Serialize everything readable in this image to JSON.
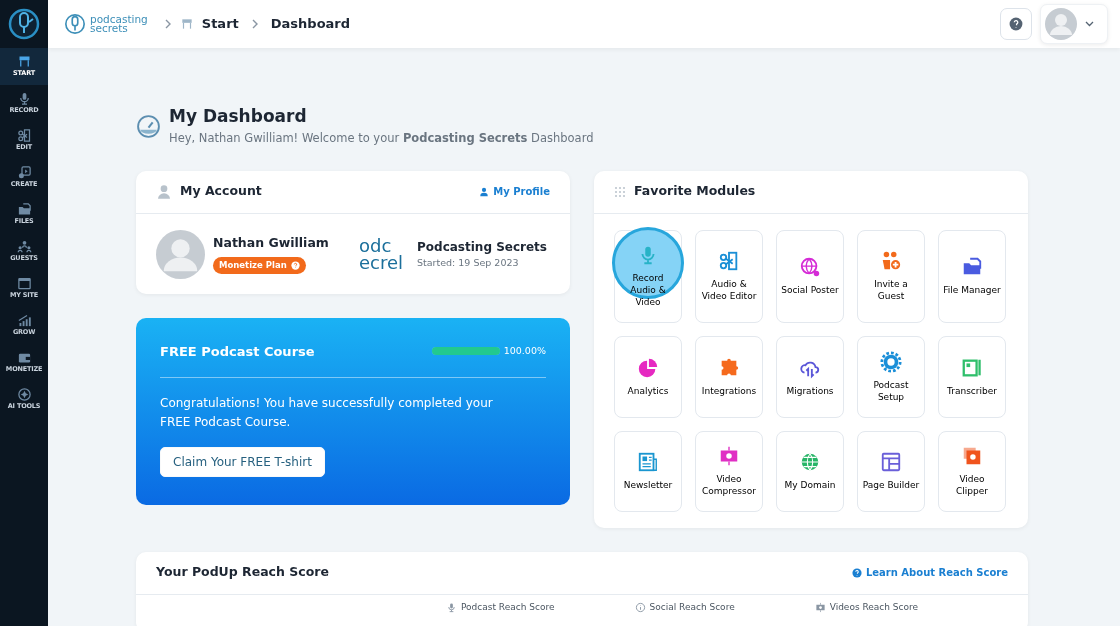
{
  "sidebar": {
    "items": [
      {
        "label": "START",
        "kind": "barrier",
        "selected": true
      },
      {
        "label": "RECORD",
        "kind": "mic",
        "selected": false
      },
      {
        "label": "EDIT",
        "kind": "scissors",
        "selected": false
      },
      {
        "label": "CREATE",
        "kind": "play",
        "selected": false
      },
      {
        "label": "FILES",
        "kind": "folder",
        "selected": false
      },
      {
        "label": "GUESTS",
        "kind": "people",
        "selected": false
      },
      {
        "label": "MY SITE",
        "kind": "window",
        "selected": false
      },
      {
        "label": "GROW",
        "kind": "chart",
        "selected": false
      },
      {
        "label": "MONETIZE",
        "kind": "wallet",
        "selected": false
      },
      {
        "label": "AI TOOLS",
        "kind": "sparkle",
        "selected": false
      }
    ]
  },
  "header": {
    "logo_text": [
      "podcasting",
      "secrets"
    ],
    "breadcrumb": [
      "Start",
      "Dashboard"
    ]
  },
  "page": {
    "title": "My Dashboard",
    "subtitle": "Hey, Nathan Gwilliam! Welcome to your **Podcasting Secrets** Dashboard"
  },
  "account": {
    "title": "My Account",
    "profile_link": "My Profile",
    "name": "Nathan Gwilliam",
    "plan": "Monetize Plan",
    "podcast_logo_text": [
      "odc",
      "ecrel"
    ],
    "podcast_name": "Podcasting Secrets",
    "started": "Started: 19 Sep 2023"
  },
  "course": {
    "title": "FREE Podcast Course",
    "level": 1.0,
    "reading": "100.00%",
    "message": "Congratulations! You have successfully completed your FREE Podcast Course.",
    "button": "Claim Your FREE T-shirt"
  },
  "modules": {
    "title": "Favorite Modules",
    "items": [
      {
        "label": "Record Audio & Video",
        "kind": "mic",
        "highlighted": true
      },
      {
        "label": "Audio & Video Editor",
        "kind": "scissors",
        "highlighted": false
      },
      {
        "label": "Social Poster",
        "kind": "globe-share",
        "highlighted": false
      },
      {
        "label": "Invite a Guest",
        "kind": "people-plus",
        "highlighted": false
      },
      {
        "label": "File Manager",
        "kind": "folder",
        "highlighted": false
      },
      {
        "label": "Analytics",
        "kind": "pie",
        "highlighted": false
      },
      {
        "label": "Integrations",
        "kind": "puzzle",
        "highlighted": false
      },
      {
        "label": "Migrations",
        "kind": "cloud",
        "highlighted": false
      },
      {
        "label": "Podcast Setup",
        "kind": "gear",
        "highlighted": false
      },
      {
        "label": "Transcriber",
        "kind": "notebook",
        "highlighted": false
      },
      {
        "label": "Newsletter",
        "kind": "newspaper",
        "highlighted": false
      },
      {
        "label": "Video Compressor",
        "kind": "film",
        "highlighted": false
      },
      {
        "label": "My Domain",
        "kind": "globe",
        "highlighted": false
      },
      {
        "label": "Page Builder",
        "kind": "layout",
        "highlighted": false
      },
      {
        "label": "Video Clipper",
        "kind": "clipper",
        "highlighted": false
      }
    ]
  },
  "reach": {
    "title": "Your PodUp Reach Score",
    "link": "Learn About Reach Score",
    "scores": [
      {
        "label": "Podcast Reach Score",
        "kind": "mic"
      },
      {
        "label": "Social Reach Score",
        "kind": "info"
      },
      {
        "label": "Videos Reach Score",
        "kind": "film"
      }
    ]
  }
}
